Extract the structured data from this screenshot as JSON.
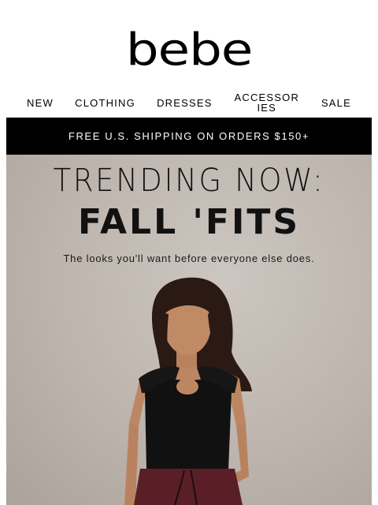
{
  "header": {
    "logo": "bebe"
  },
  "nav": {
    "items": [
      {
        "label": "NEW"
      },
      {
        "label": "CLOTHING"
      },
      {
        "label": "DRESSES"
      },
      {
        "label": "ACCESSORIES"
      },
      {
        "label": "SALE"
      }
    ]
  },
  "banner": {
    "text": "FREE U.S. SHIPPING ON ORDERS $150+"
  },
  "hero": {
    "title_line1": "TRENDING NOW:",
    "title_line2": "FALL 'FITS",
    "subtitle": "The looks you'll want before everyone else does."
  },
  "colors": {
    "banner_bg": "#000000",
    "hero_bg": "#bcb4ad",
    "top": "#111111",
    "skirt": "#5a1f26"
  }
}
